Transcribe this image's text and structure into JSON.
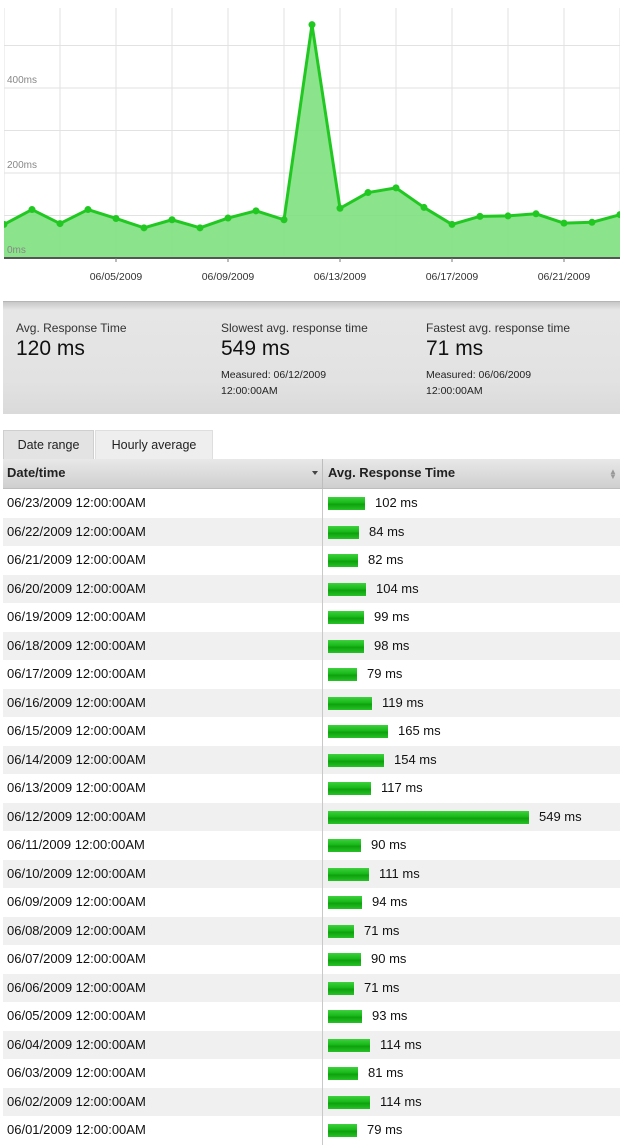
{
  "chart_data": {
    "type": "area",
    "x": [
      "06/01/2009",
      "06/02/2009",
      "06/03/2009",
      "06/04/2009",
      "06/05/2009",
      "06/06/2009",
      "06/07/2009",
      "06/08/2009",
      "06/09/2009",
      "06/10/2009",
      "06/11/2009",
      "06/12/2009",
      "06/13/2009",
      "06/14/2009",
      "06/15/2009",
      "06/16/2009",
      "06/17/2009",
      "06/18/2009",
      "06/19/2009",
      "06/20/2009",
      "06/21/2009",
      "06/22/2009",
      "06/23/2009"
    ],
    "values": [
      79,
      114,
      81,
      114,
      93,
      71,
      90,
      71,
      94,
      111,
      90,
      549,
      117,
      154,
      165,
      119,
      79,
      98,
      99,
      104,
      82,
      84,
      102
    ],
    "y_ticks": [
      "0ms",
      "200ms",
      "400ms"
    ],
    "x_tick_labels": [
      "06/05/2009",
      "06/09/2009",
      "06/13/2009",
      "06/17/2009",
      "06/21/2009"
    ],
    "ylim": [
      0,
      600
    ],
    "grid": true,
    "line_color": "#22c822",
    "fill_color": "#7ee07e"
  },
  "stats": {
    "avg": {
      "label": "Avg. Response Time",
      "value": "120 ms"
    },
    "slowest": {
      "label": "Slowest avg. response time",
      "value": "549 ms",
      "measured": "Measured: 06/12/2009 12:00:00AM"
    },
    "fastest": {
      "label": "Fastest avg. response time",
      "value": "71 ms",
      "measured": "Measured: 06/06/2009 12:00:00AM"
    }
  },
  "tabs": [
    {
      "label": "Date range",
      "active": true
    },
    {
      "label": "Hourly average",
      "active": false
    }
  ],
  "table": {
    "headers": {
      "date": "Date/time",
      "response": "Avg. Response Time"
    },
    "rows": [
      {
        "date": "06/23/2009 12:00:00AM",
        "value": 102,
        "label": "102 ms"
      },
      {
        "date": "06/22/2009 12:00:00AM",
        "value": 84,
        "label": "84 ms"
      },
      {
        "date": "06/21/2009 12:00:00AM",
        "value": 82,
        "label": "82 ms"
      },
      {
        "date": "06/20/2009 12:00:00AM",
        "value": 104,
        "label": "104 ms"
      },
      {
        "date": "06/19/2009 12:00:00AM",
        "value": 99,
        "label": "99 ms"
      },
      {
        "date": "06/18/2009 12:00:00AM",
        "value": 98,
        "label": "98 ms"
      },
      {
        "date": "06/17/2009 12:00:00AM",
        "value": 79,
        "label": "79 ms"
      },
      {
        "date": "06/16/2009 12:00:00AM",
        "value": 119,
        "label": "119 ms"
      },
      {
        "date": "06/15/2009 12:00:00AM",
        "value": 165,
        "label": "165 ms"
      },
      {
        "date": "06/14/2009 12:00:00AM",
        "value": 154,
        "label": "154 ms"
      },
      {
        "date": "06/13/2009 12:00:00AM",
        "value": 117,
        "label": "117 ms"
      },
      {
        "date": "06/12/2009 12:00:00AM",
        "value": 549,
        "label": "549 ms"
      },
      {
        "date": "06/11/2009 12:00:00AM",
        "value": 90,
        "label": "90 ms"
      },
      {
        "date": "06/10/2009 12:00:00AM",
        "value": 111,
        "label": "111 ms"
      },
      {
        "date": "06/09/2009 12:00:00AM",
        "value": 94,
        "label": "94 ms"
      },
      {
        "date": "06/08/2009 12:00:00AM",
        "value": 71,
        "label": "71 ms"
      },
      {
        "date": "06/07/2009 12:00:00AM",
        "value": 90,
        "label": "90 ms"
      },
      {
        "date": "06/06/2009 12:00:00AM",
        "value": 71,
        "label": "71 ms"
      },
      {
        "date": "06/05/2009 12:00:00AM",
        "value": 93,
        "label": "93 ms"
      },
      {
        "date": "06/04/2009 12:00:00AM",
        "value": 114,
        "label": "114 ms"
      },
      {
        "date": "06/03/2009 12:00:00AM",
        "value": 81,
        "label": "81 ms"
      },
      {
        "date": "06/02/2009 12:00:00AM",
        "value": 114,
        "label": "114 ms"
      },
      {
        "date": "06/01/2009 12:00:00AM",
        "value": 79,
        "label": "79 ms"
      }
    ]
  }
}
